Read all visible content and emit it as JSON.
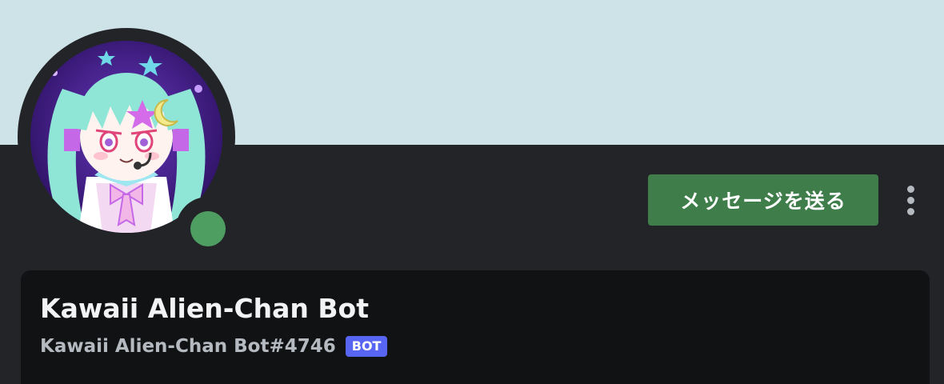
{
  "banner": {
    "color": "#cde3e8"
  },
  "avatar": {
    "status": "online",
    "status_color": "#4e9e62"
  },
  "actions": {
    "send_message_label": "メッセージを送る",
    "more_icon": "more-vertical-icon"
  },
  "profile": {
    "display_name": "Kawaii Alien-Chan Bot",
    "username": "Kawaii Alien-Chan Bot#4746",
    "badge": "BOT"
  },
  "colors": {
    "accent_green": "#3f7d4b",
    "bot_badge": "#5865f2",
    "card_background": "#111214",
    "page_background": "#232428"
  }
}
